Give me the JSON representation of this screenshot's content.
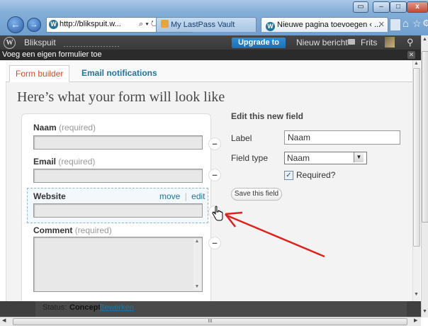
{
  "browser": {
    "address": "http://blikspuit.w...",
    "address_controls": "⌕ ▾ ↻ ✕",
    "tabs": [
      {
        "label": "My LastPass Vault"
      },
      {
        "label": "Nieuwe pagina toevoegen ‹ ...",
        "close": "✕"
      }
    ],
    "home_icon": "home-icon",
    "star_icon": "star-icon",
    "gear_icon": "gear-icon"
  },
  "adminbar": {
    "site_name": "Blikspuit",
    "upgrade": "Upgrade to Pro",
    "new_post": "Nieuw bericht",
    "user": "Frits",
    "search_icon": "search-icon"
  },
  "dialog": {
    "title": "Voeg een eigen formulier toe",
    "close": "✕"
  },
  "tabs": {
    "form_builder": "Form builder",
    "email_notifications": "Email notifications"
  },
  "preview": {
    "heading": "Here’s what your form will look like",
    "fields": [
      {
        "label": "Naam",
        "required": "(required)"
      },
      {
        "label": "Email",
        "required": "(required)"
      },
      {
        "label": "Website",
        "move": "move",
        "separator": "|",
        "edit": "edit"
      },
      {
        "label": "Comment",
        "required": "(required)"
      }
    ],
    "remove_symbol": "–"
  },
  "edit_panel": {
    "title": "Edit this new field",
    "label_label": "Label",
    "label_value": "Naam",
    "type_label": "Field type",
    "type_value": "Naam",
    "required_label": "Required?",
    "required_checked": true,
    "save_button": "Save this field"
  },
  "statusbar": {
    "status_prefix": "Status:",
    "status_value": "Concept",
    "edit_link": "Bewerken"
  },
  "scrollbar": {
    "grip": "III"
  },
  "colors": {
    "wp_blue": "#21759b",
    "tab_orange": "#d54e21",
    "upgrade_blue": "#1a6fb5",
    "annotation_arrow": "#e0211b"
  }
}
